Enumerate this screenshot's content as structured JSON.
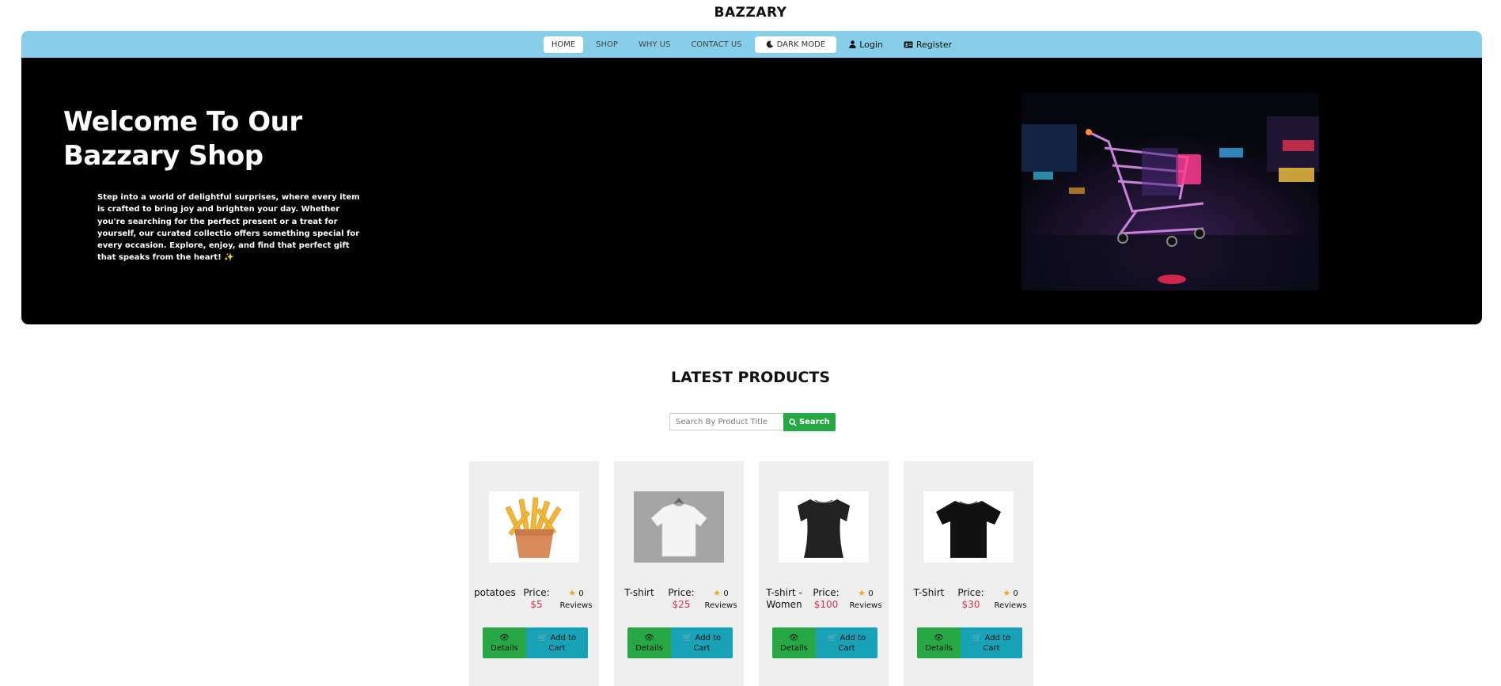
{
  "brand": "BAZZARY",
  "nav": {
    "items": [
      "HOME",
      "SHOP",
      "WHY US",
      "CONTACT US"
    ],
    "dark_mode": "DARK MODE",
    "login": "Login",
    "register": "Register"
  },
  "hero": {
    "title_line1": "Welcome To Our",
    "title_line2": "Bazzary Shop",
    "text": "Step into a world of delightful surprises, where every item is crafted to bring joy and brighten your day. Whether you're searching for the perfect present or a treat for yourself, our curated collectio offers something special for every occasion. Explore, enjoy, and find that perfect gift that speaks from the heart! ✨"
  },
  "products_section": {
    "title": "LATEST PRODUCTS",
    "search_placeholder": "Search By Product Title",
    "search_button": "Search"
  },
  "products": [
    {
      "title": "potatoes",
      "price_label": "Price:",
      "price": "$5",
      "reviews_count": "0",
      "reviews_label": "Reviews",
      "details": "Details",
      "cart": "Add to Cart",
      "icon": "fries-image"
    },
    {
      "title": "T-shirt",
      "price_label": "Price:",
      "price": "$25",
      "reviews_count": "0",
      "reviews_label": "Reviews",
      "details": "Details",
      "cart": "Add to Cart",
      "icon": "white-tshirt-image"
    },
    {
      "title": "T-shirt - Women",
      "price_label": "Price:",
      "price": "$100",
      "reviews_count": "0",
      "reviews_label": "Reviews",
      "details": "Details",
      "cart": "Add to Cart",
      "icon": "black-tshirt-women-image"
    },
    {
      "title": "T-Shirt",
      "price_label": "Price:",
      "price": "$30",
      "reviews_count": "0",
      "reviews_label": "Reviews",
      "details": "Details",
      "cart": "Add to Cart",
      "icon": "black-tshirt-image"
    }
  ],
  "colors": {
    "navbar": "#87ceeb",
    "hero_bg": "#000000",
    "success": "#28a745",
    "info": "#17a2b8",
    "price": "#dc3545",
    "star": "#f5a623"
  }
}
